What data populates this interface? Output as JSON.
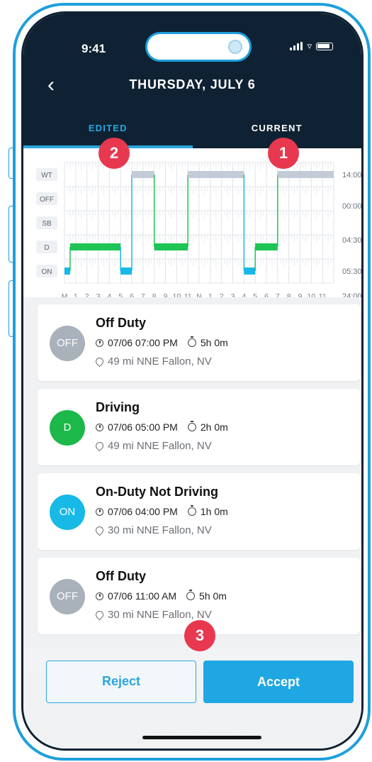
{
  "status_bar": {
    "time": "9:41"
  },
  "header": {
    "title": "THURSDAY, JULY 6",
    "tabs": [
      {
        "label": "EDITED",
        "active": true
      },
      {
        "label": "CURRENT",
        "active": false
      }
    ]
  },
  "chart": {
    "rows": [
      "WT",
      "OFF",
      "SB",
      "D",
      "ON"
    ],
    "hour_labels": [
      "M",
      "1",
      "2",
      "3",
      "4",
      "5",
      "6",
      "7",
      "8",
      "9",
      "10",
      "11",
      "N",
      "1",
      "2",
      "3",
      "4",
      "5",
      "6",
      "7",
      "8",
      "9",
      "10",
      "11"
    ],
    "totals": [
      "14:00",
      "00:00",
      "04:30",
      "05:30",
      "24:00"
    ],
    "segments": [
      {
        "row": "ON",
        "start": 0,
        "end": 0.5
      },
      {
        "row": "D",
        "start": 0.5,
        "end": 5.0
      },
      {
        "row": "ON",
        "start": 5.0,
        "end": 6.0
      },
      {
        "row": "WT",
        "start": 6.0,
        "end": 8.0
      },
      {
        "row": "D",
        "start": 8.0,
        "end": 11.0
      },
      {
        "row": "WT",
        "start": 11.0,
        "end": 16.0
      },
      {
        "row": "ON",
        "start": 16.0,
        "end": 17.0
      },
      {
        "row": "D",
        "start": 17.0,
        "end": 19.0
      },
      {
        "row": "WT",
        "start": 19.0,
        "end": 24.0
      }
    ],
    "colors": {
      "driving": "#1ec455",
      "on_duty": "#17b9e6",
      "off": "#c2cbd6"
    }
  },
  "events": [
    {
      "status": "OFF",
      "title": "Off Duty",
      "time": "07/06 07:00 PM",
      "duration": "5h 0m",
      "location": "49 mi NNE Fallon, NV",
      "color": "#a9b1bb"
    },
    {
      "status": "D",
      "title": "Driving",
      "time": "07/06 05:00 PM",
      "duration": "2h 0m",
      "location": "49 mi NNE Fallon, NV",
      "color": "#1cb84a"
    },
    {
      "status": "ON",
      "title": "On-Duty Not Driving",
      "time": "07/06 04:00 PM",
      "duration": "1h 0m",
      "location": "30 mi NNE Fallon, NV",
      "color": "#17b9e6"
    },
    {
      "status": "OFF",
      "title": "Off Duty",
      "time": "07/06 11:00 AM",
      "duration": "5h 0m",
      "location": "30 mi NNE Fallon, NV",
      "color": "#a9b1bb"
    }
  ],
  "actions": {
    "reject_label": "Reject",
    "accept_label": "Accept"
  },
  "markers": {
    "m1": "1",
    "m2": "2",
    "m3": "3"
  }
}
